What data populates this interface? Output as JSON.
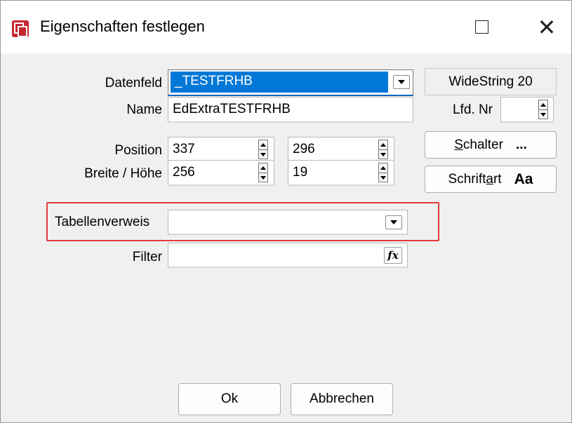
{
  "window": {
    "title": "Eigenschaften festlegen",
    "app_icon": "properties-app-icon",
    "maximize_icon": "maximize-icon",
    "close_icon": "close-icon",
    "close_glyph": "✕"
  },
  "form": {
    "datenfeld": {
      "label": "Datenfeld",
      "value": "_TESTFRHB",
      "type_info": "WideString 20"
    },
    "name": {
      "label": "Name",
      "value": "EdExtraTESTFRHB"
    },
    "lfd_nr": {
      "label": "Lfd. Nr",
      "value": ""
    },
    "position": {
      "label": "Position",
      "x": "337",
      "y": "296"
    },
    "breite_hoehe": {
      "label": "Breite / Höhe",
      "width": "256",
      "height": "19"
    },
    "tabellenverweis": {
      "label": "Tabellenverweis",
      "value": ""
    },
    "filter": {
      "label": "Filter",
      "value": "",
      "fx_label": "fx"
    }
  },
  "buttons": {
    "schalter": {
      "label_prefix": "S",
      "label_rest": "chalter",
      "suffix": "..."
    },
    "schriftart": {
      "label_prefix": "Schrift",
      "label_accel": "a",
      "label_rest": "rt",
      "suffix": "Aa"
    },
    "ok": "Ok",
    "abbrechen": "Abbrechen"
  },
  "colors": {
    "selection": "#0078d7",
    "highlight_frame": "#e23a3a",
    "dialog_bg": "#f0f0f0"
  }
}
